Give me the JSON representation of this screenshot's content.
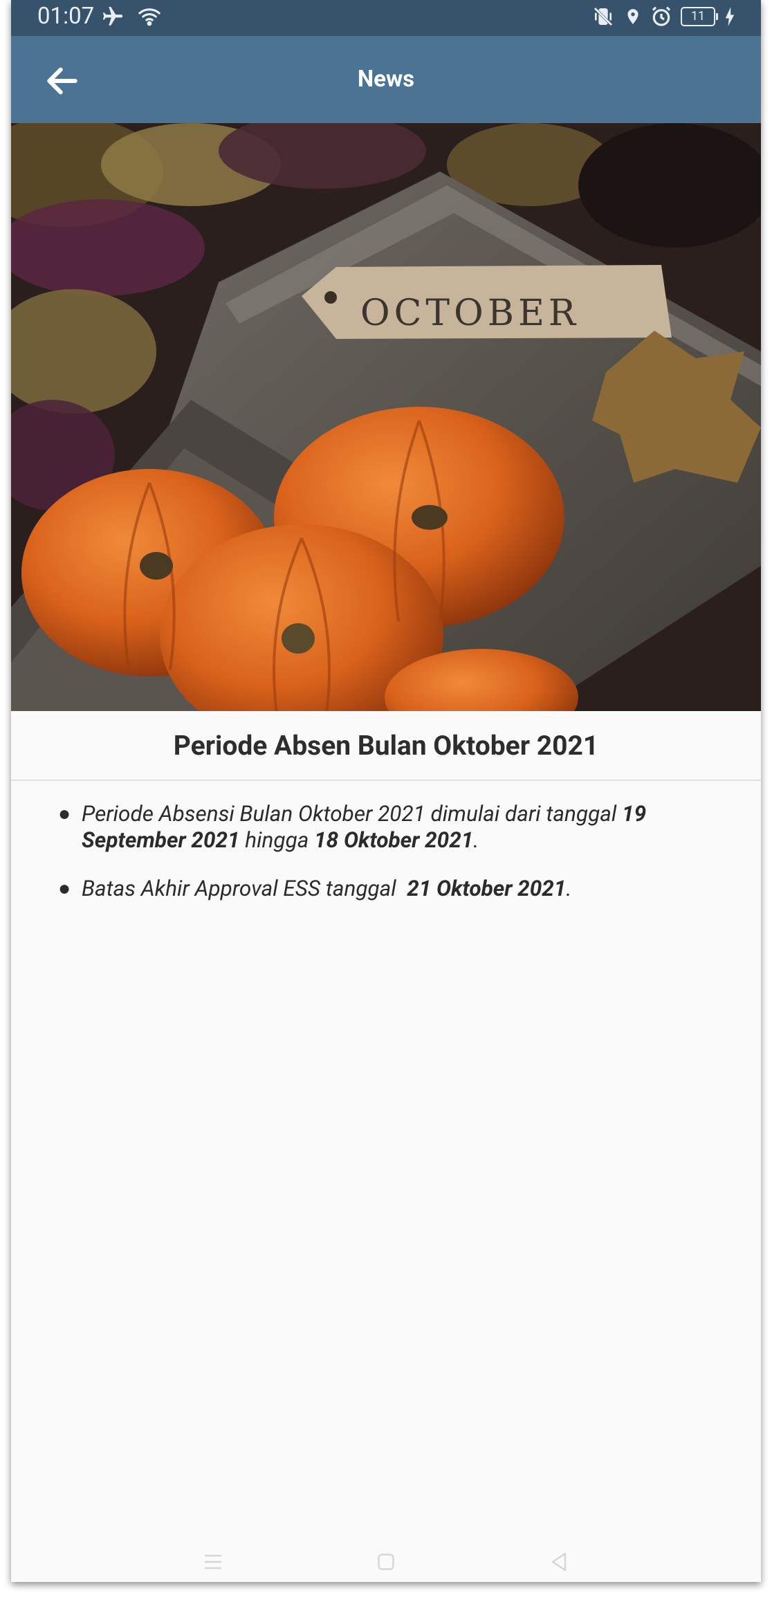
{
  "status_bar": {
    "time": "01:07",
    "battery": "11",
    "icons_left": [
      "airplane-icon",
      "wifi-icon"
    ],
    "icons_right": [
      "vibrate-icon",
      "location-icon",
      "alarm-icon",
      "battery-icon",
      "charging-icon"
    ]
  },
  "app_bar": {
    "title": "News",
    "back_icon": "arrow-left-icon"
  },
  "article": {
    "image_caption_on_tag": "OCTOBER",
    "title": "Periode Absen Bulan Oktober 2021",
    "items": [
      {
        "t1": "Periode Absensi Bulan Oktober 2021 dimulai dari tanggal ",
        "b1": "19 September 2021",
        "t2": " hingga ",
        "b2": "18 Oktober 2021",
        "t3": "."
      },
      {
        "t1": "Batas Akhir Approval ESS tanggal  ",
        "b1": "21 Oktober 2021",
        "t2": ".",
        "b2": "",
        "t3": ""
      }
    ]
  },
  "nav_bar": {
    "icons": [
      "menu-icon",
      "home-icon",
      "back-icon"
    ]
  },
  "colors": {
    "status_bar": "#36536b",
    "app_bar": "#4a7394",
    "background": "#fafafa",
    "text": "#2d2d2d"
  }
}
